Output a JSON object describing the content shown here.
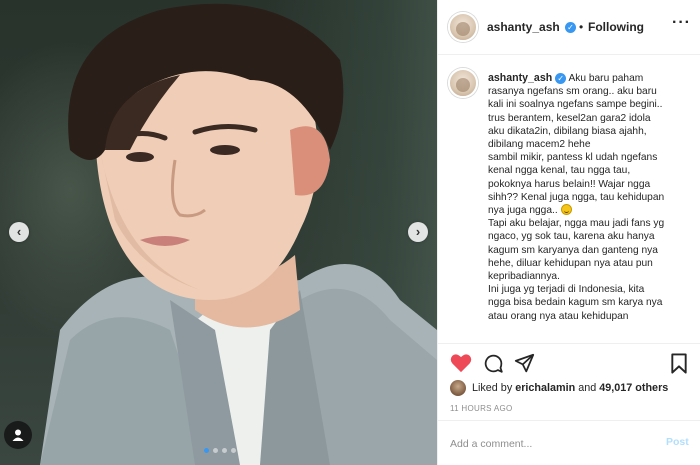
{
  "photo": {
    "prev_arrow": "‹",
    "next_arrow": "›",
    "carousel_count": 4,
    "carousel_active_index": 0,
    "tag_icon": "user-tag-icon"
  },
  "header": {
    "username": "ashanty_ash",
    "verified_mark": "✓",
    "separator": "•",
    "follow_status": "Following",
    "more_label": "···"
  },
  "caption": {
    "username": "ashanty_ash",
    "verified_mark": "✓",
    "first_line": "Aku baru paham",
    "lines": [
      "rasanya ngefans sm orang.. aku baru",
      "kali ini soalnya ngefans sampe begini..",
      "trus berantem, kesel2an gara2 idola",
      "aku dikata2in, dibilang biasa ajahh,",
      "dibilang macem2 hehe",
      "sambil mikir, pantess kl udah ngefans",
      "kenal ngga kenal, tau ngga tau,",
      "pokoknya harus belain!! Wajar ngga",
      "sihh?? Kenal juga ngga, tau kehidupan"
    ],
    "line_with_emoji": "nya juga ngga..",
    "emoji": "grinning-face-emoji",
    "lines_after": [
      "Tapi aku belajar, ngga mau jadi fans yg",
      "ngaco, yg sok tau, karena aku hanya",
      "kagum sm karyanya dan ganteng nya",
      "hehe, diluar kehidupan nya atau pun",
      "kepribadiannya.",
      "Ini juga yg terjadi di Indonesia, kita",
      "ngga bisa bedain kagum sm karya nya",
      "atau orang nya atau kehidupan"
    ]
  },
  "actions": {
    "like_icon": "heart-filled-icon",
    "comment_icon": "comment-bubble-icon",
    "share_icon": "paper-plane-icon",
    "save_icon": "bookmark-icon",
    "like_color": "#ed4956"
  },
  "likes": {
    "prefix": "Liked by ",
    "user": "erichalamin",
    "middle": " and ",
    "count": "49,017 others"
  },
  "timestamp": "11 HOURS AGO",
  "comment": {
    "placeholder": "Add a comment...",
    "post_label": "Post",
    "post_color": "#b2dffc"
  },
  "colors": {
    "verified": "#3897f0",
    "text": "#262626",
    "muted": "#8e8e8e",
    "border": "#efefef"
  }
}
